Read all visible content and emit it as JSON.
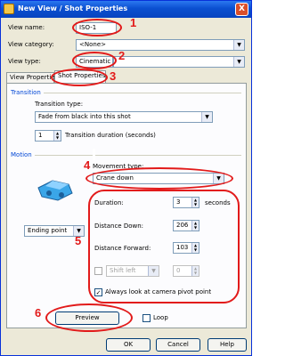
{
  "window": {
    "title": "New View / Shot Properties",
    "close_label": "X"
  },
  "fields": {
    "view_name_label": "View name:",
    "view_name_value": "ISO-1",
    "view_category_label": "View category:",
    "view_category_value": "<None>",
    "view_type_label": "View type:",
    "view_type_value": "Cinematic"
  },
  "tabs": [
    {
      "label": "View Properties"
    },
    {
      "label": "Shot Properties"
    }
  ],
  "transition": {
    "group_title": "Transition",
    "type_label": "Transition type:",
    "type_value": "Fade from black into this shot",
    "duration_value": "1",
    "duration_label": "Transition duration (seconds)"
  },
  "motion": {
    "group_title": "Motion",
    "movement_type_label": "Movement type:",
    "movement_type_value": "Crane down",
    "point_value": "Ending point",
    "duration_label": "Duration:",
    "duration_value": "3",
    "duration_unit": "seconds",
    "distance_down_label": "Distance Down:",
    "distance_down_value": "206",
    "distance_forward_label": "Distance Forward:",
    "distance_forward_value": "103",
    "shift_value": "Shift left",
    "shift_amount_value": "0",
    "always_look_label": "Always look at camera pivot point"
  },
  "buttons": {
    "preview": "Preview",
    "loop": "Loop",
    "ok": "OK",
    "cancel": "Cancel",
    "help": "Help"
  },
  "annotations": [
    "1",
    "2",
    "3",
    "4",
    "5",
    "6"
  ],
  "colors": {
    "annotation": "#e21a1a",
    "titlebar": "#0a4fd0",
    "group_title": "#0046d5"
  }
}
